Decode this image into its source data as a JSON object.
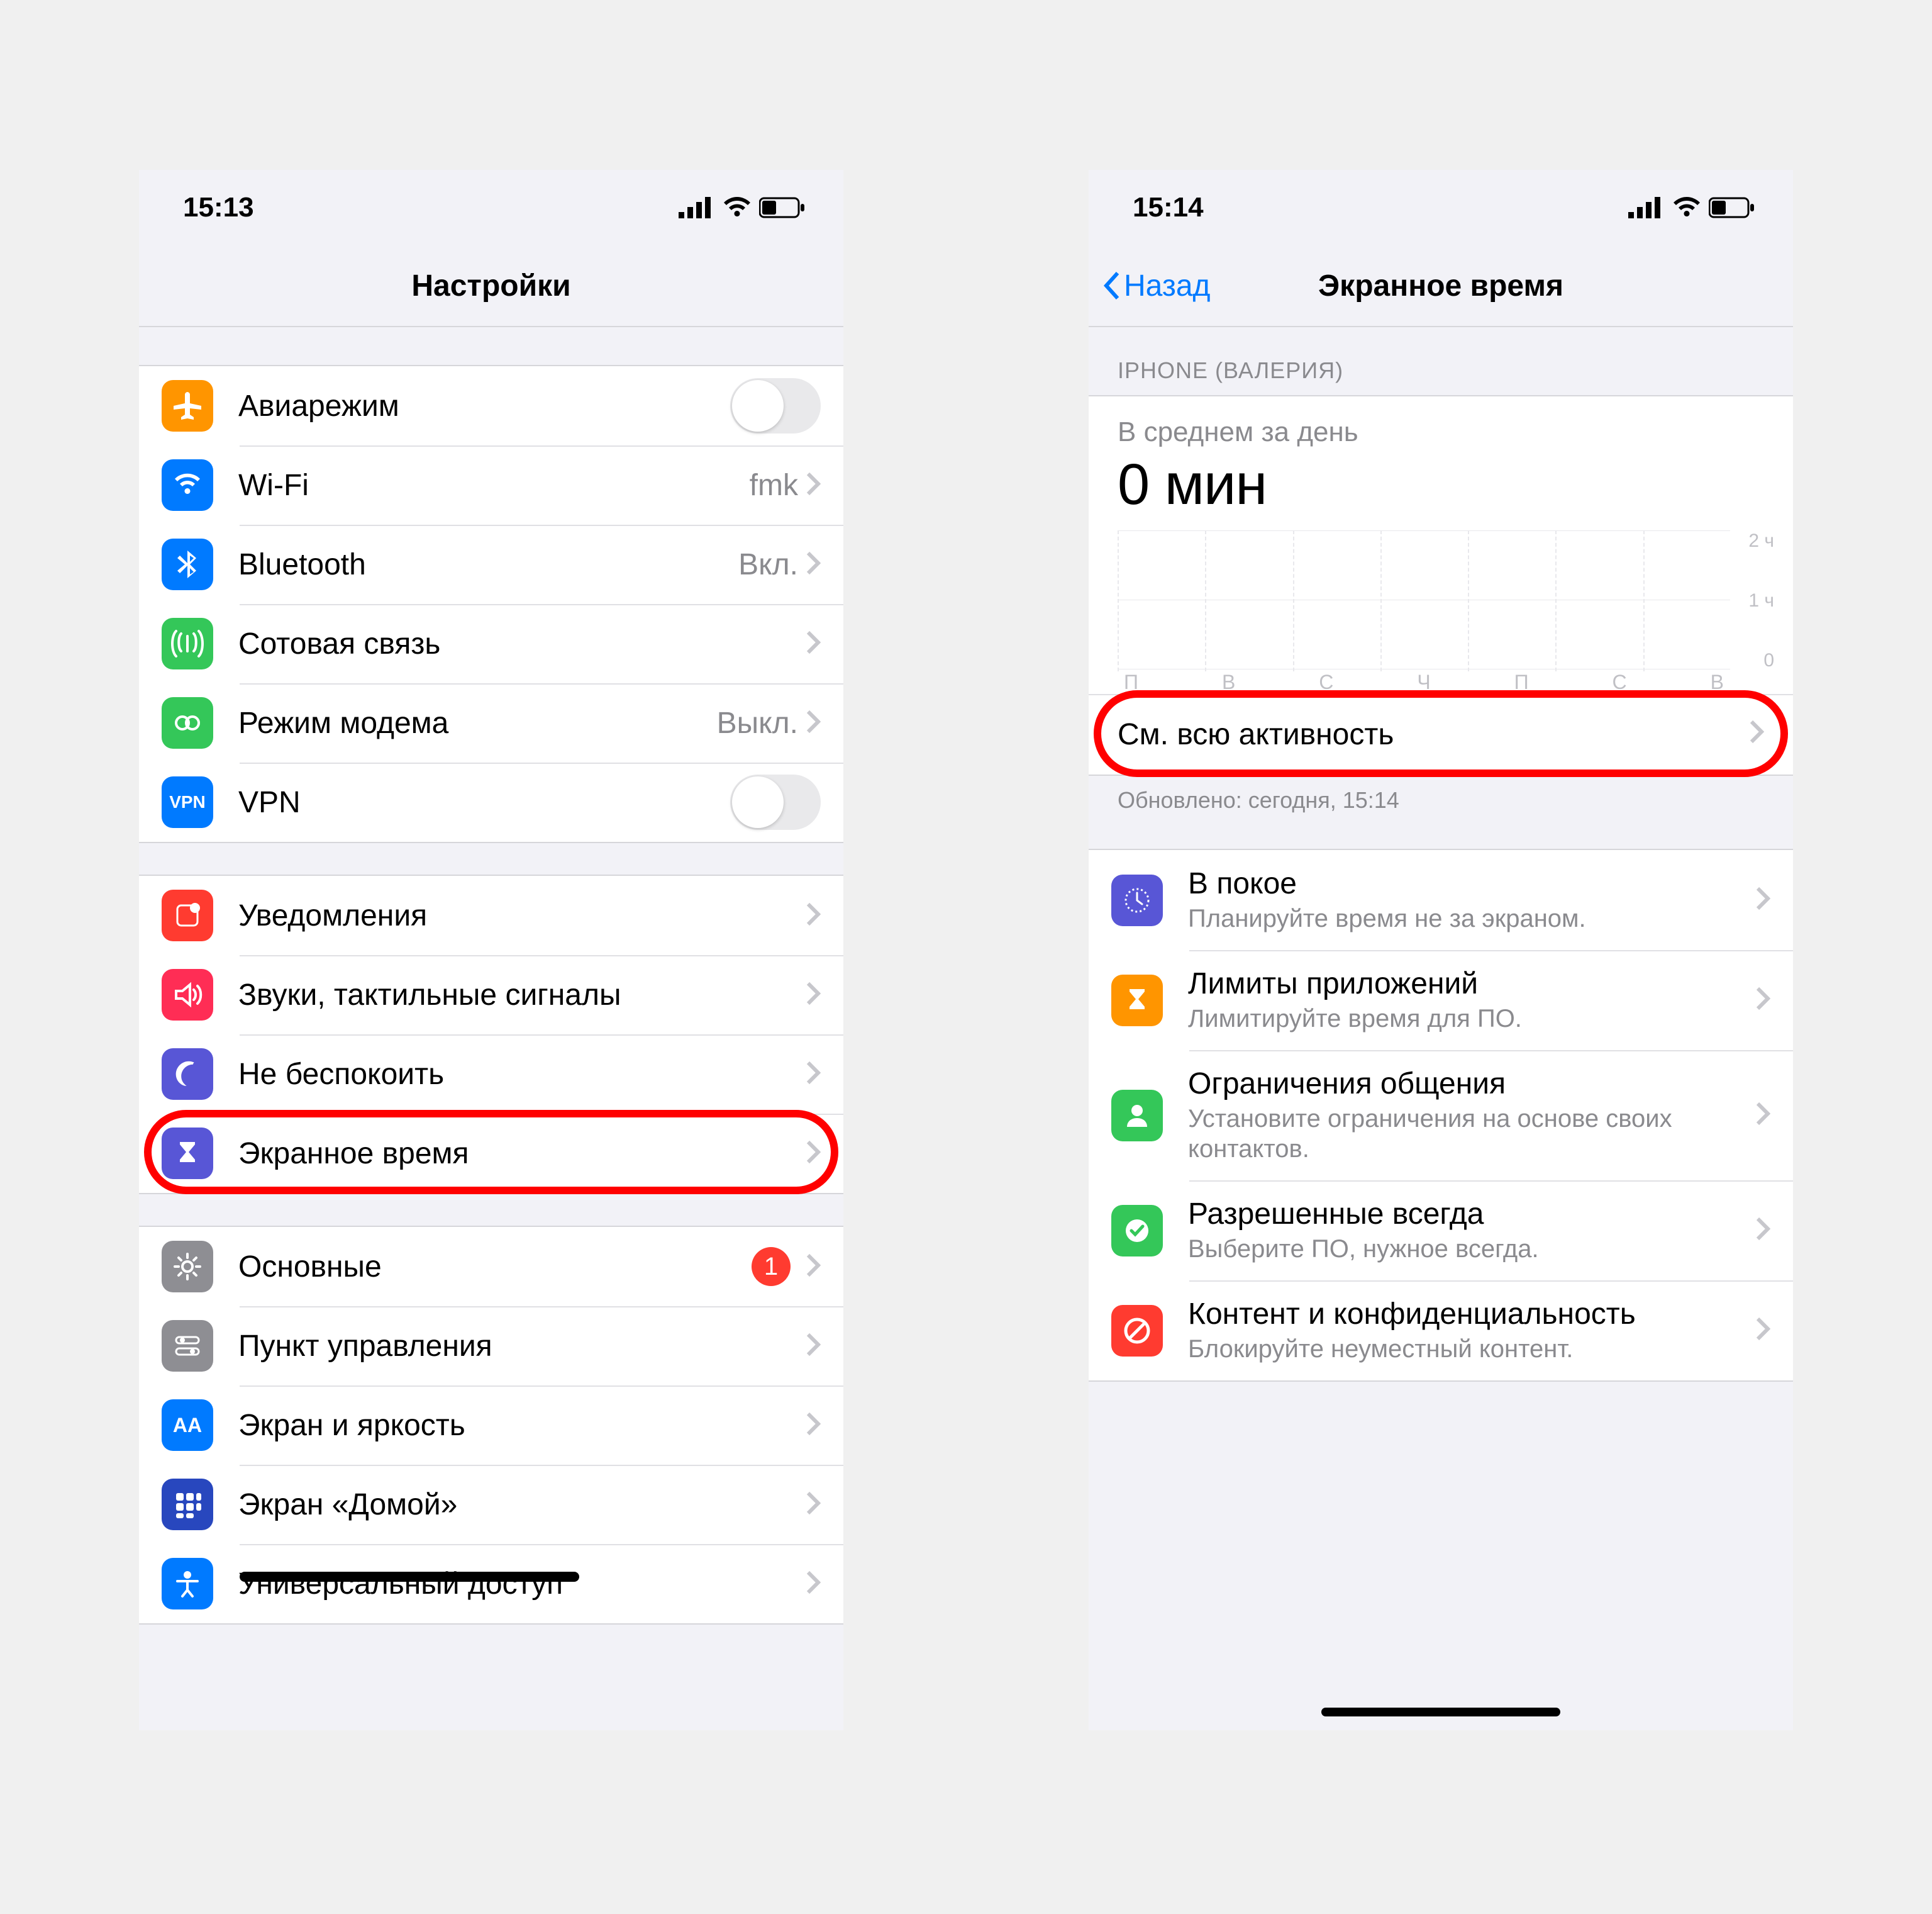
{
  "left": {
    "status": {
      "time": "15:13"
    },
    "nav": {
      "title": "Настройки"
    },
    "group1": [
      {
        "key": "airplane",
        "label": "Авиарежим",
        "tile": "#ff9500",
        "type": "toggle"
      },
      {
        "key": "wifi",
        "label": "Wi-Fi",
        "value": "fmk",
        "tile": "#007aff",
        "type": "chevron"
      },
      {
        "key": "bluetooth",
        "label": "Bluetooth",
        "value": "Вкл.",
        "tile": "#007aff",
        "type": "chevron"
      },
      {
        "key": "cellular",
        "label": "Сотовая связь",
        "tile": "#34c759",
        "type": "chevron"
      },
      {
        "key": "hotspot",
        "label": "Режим модема",
        "value": "Выкл.",
        "tile": "#34c759",
        "type": "chevron"
      },
      {
        "key": "vpn",
        "label": "VPN",
        "tile": "#007aff",
        "type": "toggle"
      }
    ],
    "group2": [
      {
        "key": "notifications",
        "label": "Уведомления",
        "tile": "#ff3b30"
      },
      {
        "key": "sounds",
        "label": "Звуки, тактильные сигналы",
        "tile": "#ff2d55"
      },
      {
        "key": "dnd",
        "label": "Не беспокоить",
        "tile": "#5856d6"
      },
      {
        "key": "screentime",
        "label": "Экранное время",
        "tile": "#5856d6"
      }
    ],
    "group3": [
      {
        "key": "general",
        "label": "Основные",
        "tile": "#8e8e93",
        "badge": "1"
      },
      {
        "key": "control",
        "label": "Пункт управления",
        "tile": "#8e8e93"
      },
      {
        "key": "display",
        "label": "Экран и яркость",
        "tile": "#007aff"
      },
      {
        "key": "home",
        "label": "Экран «Домой»",
        "tile": "#2847be"
      },
      {
        "key": "accessibility",
        "label": "Универсальный доступ",
        "tile": "#007aff"
      }
    ]
  },
  "right": {
    "status": {
      "time": "15:14"
    },
    "nav": {
      "back": "Назад",
      "title": "Экранное время"
    },
    "deviceHeader": "IPHONE (ВАЛЕРИЯ)",
    "avg": {
      "label": "В среднем за день",
      "value": "0 мин"
    },
    "activity": {
      "label": "См. всю активность",
      "updated": "Обновлено: сегодня, 15:14"
    },
    "chartYTicks": [
      "2 ч",
      "1 ч",
      "0"
    ],
    "chartDays": [
      "П",
      "В",
      "С",
      "Ч",
      "П",
      "С",
      "В"
    ],
    "config": [
      {
        "key": "downtime",
        "title": "В покое",
        "sub": "Планируйте время не за экраном.",
        "tile": "#5856d6"
      },
      {
        "key": "limits",
        "title": "Лимиты приложений",
        "sub": "Лимитируйте время для ПО.",
        "tile": "#ff9500"
      },
      {
        "key": "communication",
        "title": "Ограничения общения",
        "sub": "Установите ограничения на основе своих контактов.",
        "tile": "#34c759"
      },
      {
        "key": "allowed",
        "title": "Разрешенные всегда",
        "sub": "Выберите ПО, нужное всегда.",
        "tile": "#34c759"
      },
      {
        "key": "content",
        "title": "Контент и конфиденциальность",
        "sub": "Блокируйте неуместный контент.",
        "tile": "#ff3b30"
      }
    ]
  },
  "chart_data": {
    "type": "bar",
    "categories": [
      "П",
      "В",
      "С",
      "Ч",
      "П",
      "С",
      "В"
    ],
    "values": [
      0,
      0,
      0,
      0,
      0,
      0,
      0
    ],
    "title": "В среднем за день",
    "xlabel": "",
    "ylabel": "",
    "ylim": [
      0,
      2
    ],
    "ytick_labels": [
      "0",
      "1 ч",
      "2 ч"
    ]
  }
}
